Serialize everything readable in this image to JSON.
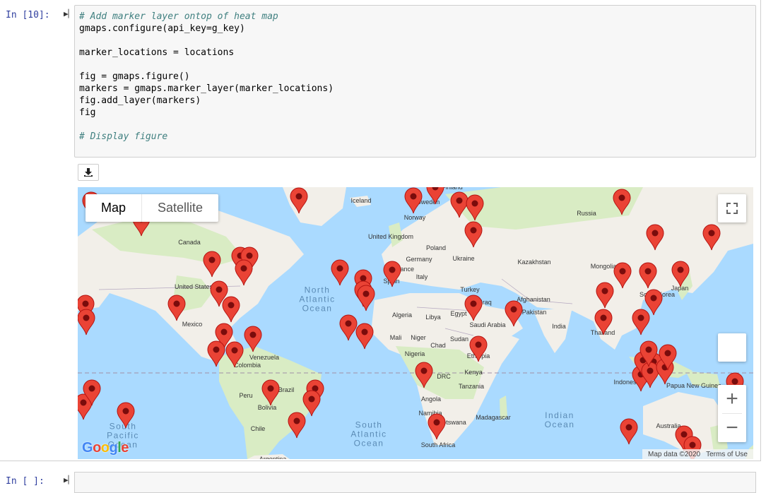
{
  "cell": {
    "prompt": "In [10]:",
    "code_lines": [
      {
        "text": "# Add marker layer ontop of heat map",
        "comment": true
      },
      {
        "text": "gmaps.configure(api_key=g_key)",
        "comment": false
      },
      {
        "text": "",
        "comment": false
      },
      {
        "text": "marker_locations = locations",
        "comment": false
      },
      {
        "text": "",
        "comment": false
      },
      {
        "text": "fig = gmaps.figure()",
        "comment": false
      },
      {
        "text": "markers = gmaps.marker_layer(marker_locations)",
        "comment": false
      },
      {
        "text": "fig.add_layer(markers)",
        "comment": false
      },
      {
        "text": "fig",
        "comment": false
      },
      {
        "text": "",
        "comment": false
      },
      {
        "text": "# Display figure",
        "comment": true
      }
    ]
  },
  "next_cell": {
    "prompt": "In [ ]:"
  },
  "map": {
    "map_type_options": [
      "Map",
      "Satellite"
    ],
    "selected_type": "Map",
    "attribution": "Map data ©2020",
    "terms": "Terms of Use",
    "logo": "Google",
    "zoom_in": "+",
    "zoom_out": "−",
    "icons": [
      "download-icon",
      "fullscreen-icon",
      "pegman-icon",
      "zoom-in-icon",
      "zoom-out-icon",
      "map-marker-icon"
    ],
    "colors": {
      "water": "#aadaff",
      "land": "#f2efe9",
      "green_land": "#d9ecc4",
      "marker": "#ea4335",
      "marker_dot": "#7a0c0c"
    },
    "country_labels": [
      "Iceland",
      "Sweden",
      "Finland",
      "Norway",
      "Russia",
      "United Kingdom",
      "Poland",
      "Canada",
      "Germany",
      "Ukraine",
      "Kazakhstan",
      "France",
      "Mongolia",
      "Spain",
      "Italy",
      "United States",
      "Turkey",
      "Japan",
      "South Korea",
      "Afghanistan",
      "Iraq",
      "Pakistan",
      "Algeria",
      "Libya",
      "Egypt",
      "Mexico",
      "Saudi Arabia",
      "India",
      "Thailand",
      "Mali",
      "Niger",
      "Sudan",
      "Chad",
      "Venezuela",
      "Nigeria",
      "Ethiopia",
      "Colombia",
      "Kenya",
      "DRC",
      "Tanzania",
      "Indonesia",
      "Papua New Guinea",
      "Peru",
      "Brazil",
      "Angola",
      "Bolivia",
      "Namibia",
      "Botswana",
      "Madagascar",
      "Chile",
      "Australia",
      "South Africa",
      "Argentina"
    ],
    "ocean_labels": [
      "North Atlantic Ocean",
      "South Pacific Ocean",
      "South Atlantic Ocean",
      "Indian Ocean"
    ]
  }
}
